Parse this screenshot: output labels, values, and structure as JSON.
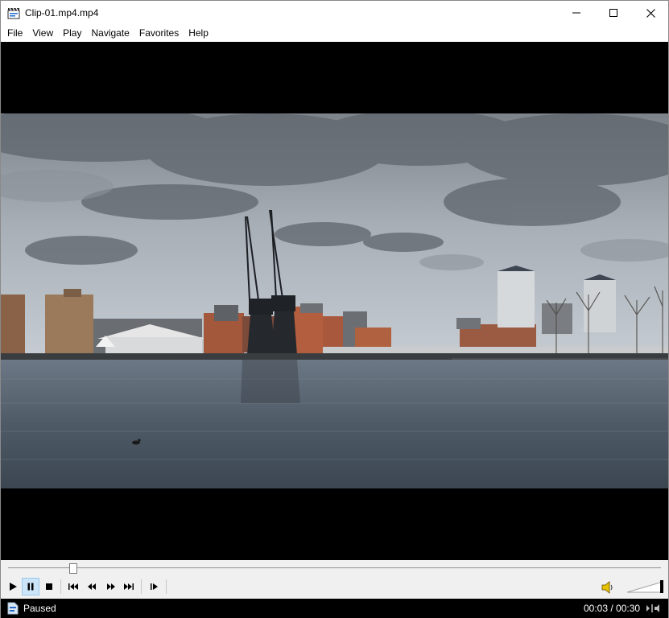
{
  "window": {
    "title": "Clip-01.mp4.mp4"
  },
  "menu": [
    {
      "label": "File"
    },
    {
      "label": "View"
    },
    {
      "label": "Play"
    },
    {
      "label": "Navigate"
    },
    {
      "label": "Favorites"
    },
    {
      "label": "Help"
    }
  ],
  "icons": {
    "app": "clapperboard-icon",
    "minimize": "minimize-icon",
    "maximize": "maximize-icon",
    "close": "close-icon",
    "play": "play-icon",
    "pause": "pause-icon",
    "stop": "stop-icon",
    "previous": "skip-back-icon",
    "rewind": "rewind-icon",
    "fast_forward": "fast-forward-icon",
    "next": "skip-forward-icon",
    "frame_step": "frame-step-icon",
    "volume": "speaker-icon",
    "status": "document-icon",
    "sync": "audio-sync-icon"
  },
  "seek": {
    "position_fraction": 0.1
  },
  "player": {
    "pause_pressed": true,
    "volume_fraction": 1.0
  },
  "status": {
    "state": "Paused",
    "time": "00:03 / 00:30"
  },
  "colors": {
    "video_background": "#000000",
    "pressed_button": "#cce4f7",
    "toolbar_background": "#f0f0f0"
  }
}
